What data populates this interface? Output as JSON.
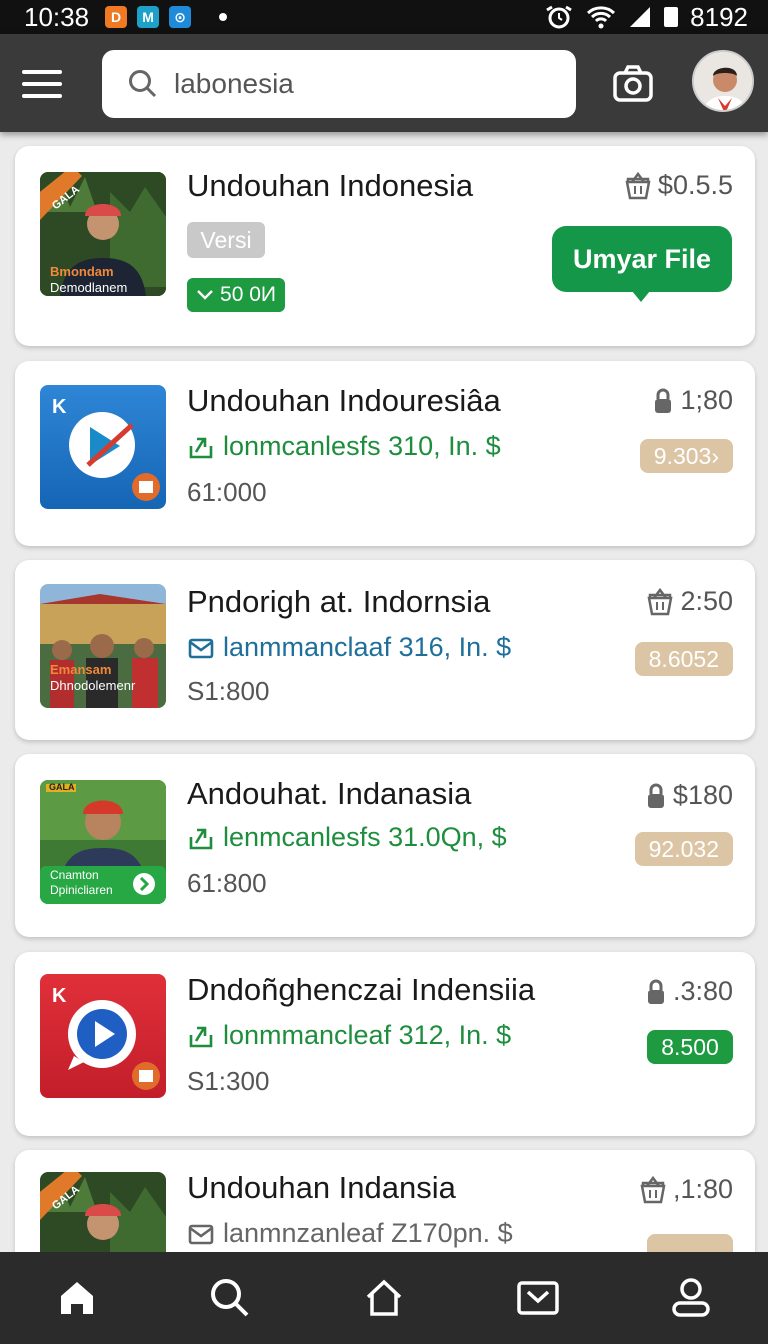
{
  "status_bar": {
    "time": "10:38",
    "right_text": "8192",
    "notif_icons": [
      {
        "name": "notif-icon-orange",
        "color": "#f07a23",
        "glyph": "D"
      },
      {
        "name": "notif-icon-teal",
        "color": "#1ea0c9",
        "glyph": "M"
      },
      {
        "name": "notif-icon-blue",
        "color": "#1f8ad8",
        "glyph": "⊙"
      }
    ]
  },
  "app_bar": {
    "search_value": "labonesia"
  },
  "featured": {
    "title": "Undouhan Indonesia",
    "version_label": "Versi",
    "count_label": "50 0И",
    "price": "$0.5.5",
    "button_label": "Umyar File",
    "thumb_caption_top": "Bmondam",
    "thumb_caption_bottom": "Demodlanem",
    "thumb_corner": "GALA"
  },
  "items": [
    {
      "title": "Undouhan Indouresiâa",
      "subtitle": "lonmcanlesfs 310, In. $",
      "subtitle_icon": "share-up",
      "size": "61:000",
      "price": "1;80",
      "price_icon": "lock",
      "badge": "9.303›",
      "badge_style": "tan",
      "thumb": "blue-play"
    },
    {
      "title": "Pndorigh at. Indornsia",
      "subtitle": "lanmmanclaaf 316, In. $",
      "subtitle_icon": "mail",
      "size": "S1:800",
      "price": "2:50",
      "price_icon": "basket",
      "badge": "8.6052",
      "badge_style": "tan",
      "thumb": "people",
      "thumb_caption_top": "Emansam",
      "thumb_caption_bottom": "Dhnodolemenr"
    },
    {
      "title": "Andouhat. Indanasia",
      "subtitle": "lenmcanlesfs 31.0Qn, $",
      "subtitle_icon": "share-up",
      "size": "61:800",
      "price": "$180",
      "price_icon": "lock",
      "badge": "92.032",
      "badge_style": "tan",
      "thumb": "man-green",
      "thumb_caption_top": "Cnamton",
      "thumb_caption_bottom": "Dpinicliaren",
      "thumb_corner": "GALA"
    },
    {
      "title": "Dndoñghenczai Indensiia",
      "subtitle": "lonmmancleaf 312, In. $",
      "subtitle_icon": "share-up",
      "size": "S1:300",
      "price": ".3:80",
      "price_icon": "lock",
      "badge": "8.500",
      "badge_style": "green",
      "thumb": "red-play"
    },
    {
      "title": "Undouhan Indansia",
      "subtitle": "lanmnzanleaf Z170pn. $",
      "subtitle_icon": "mail",
      "size": "",
      "price": ",1:80",
      "price_icon": "basket",
      "badge": "",
      "badge_style": "tan",
      "thumb": "man-orange",
      "thumb_corner": "GALA"
    }
  ],
  "colors": {
    "green_text": "#1e8e3e",
    "blue_text": "#1e6f9a",
    "tan_badge": "#dcc5a4",
    "green_badge": "#1e9a40",
    "app_bar": "#3a3a3a",
    "nav_bar": "#2b2b2b"
  },
  "bottom_nav": [
    "home-icon",
    "search-icon",
    "house-outline-icon",
    "inbox-icon",
    "profile-icon"
  ]
}
